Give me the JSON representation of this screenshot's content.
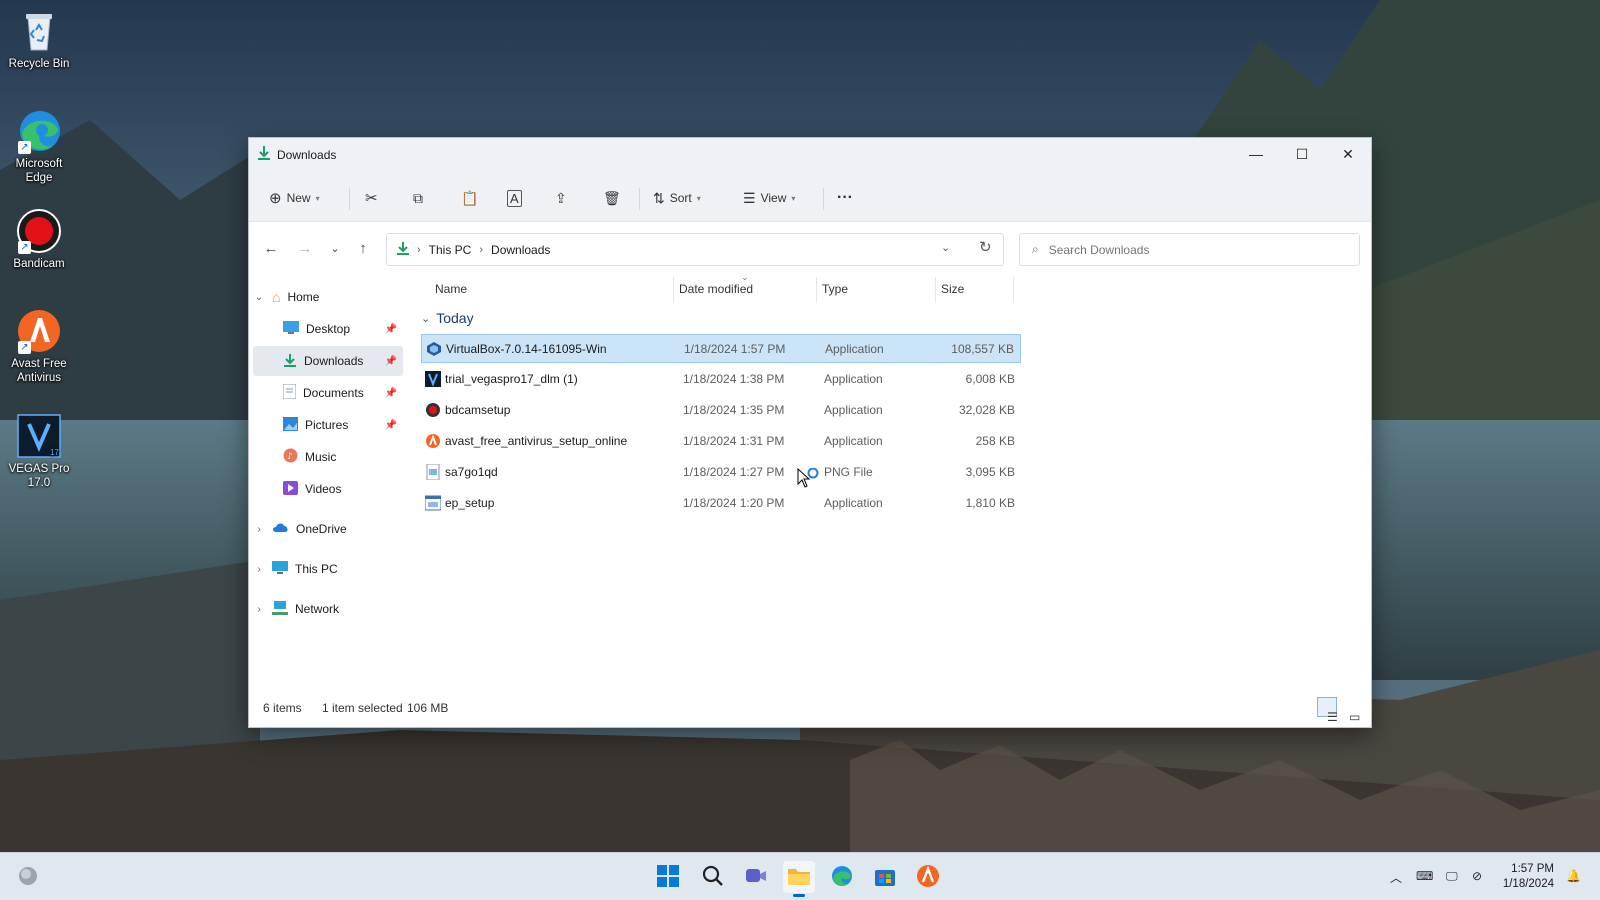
{
  "desktop": {
    "icons": [
      {
        "label": "Recycle Bin",
        "icon": "recycle-bin-icon"
      },
      {
        "label": "Microsoft Edge",
        "icon": "edge-icon"
      },
      {
        "label": "Bandicam",
        "icon": "bandicam-icon"
      },
      {
        "label": "Avast Free Antivirus",
        "icon": "avast-icon"
      },
      {
        "label": "VEGAS Pro 17.0",
        "icon": "vegas-icon"
      }
    ]
  },
  "window": {
    "title": "Downloads",
    "toolbar": {
      "new_label": "New",
      "sort_label": "Sort",
      "view_label": "View",
      "more_label": "···"
    },
    "address": {
      "crumbs": [
        "This PC",
        "Downloads"
      ],
      "search_placeholder": "Search Downloads"
    },
    "nav": {
      "home": "Home",
      "quick": [
        {
          "label": "Desktop",
          "pinned": true
        },
        {
          "label": "Downloads",
          "pinned": true,
          "selected": true
        },
        {
          "label": "Documents",
          "pinned": true
        },
        {
          "label": "Pictures",
          "pinned": true
        },
        {
          "label": "Music",
          "pinned": false
        },
        {
          "label": "Videos",
          "pinned": false
        }
      ],
      "onedrive": "OneDrive",
      "thispc": "This PC",
      "network": "Network"
    },
    "columns": {
      "name": "Name",
      "date": "Date modified",
      "type": "Type",
      "size": "Size"
    },
    "group": "Today",
    "files": [
      {
        "name": "VirtualBox-7.0.14-161095-Win",
        "date": "1/18/2024 1:57 PM",
        "type": "Application",
        "size": "108,557 KB",
        "selected": true,
        "icon": "virtualbox-icon"
      },
      {
        "name": "trial_vegaspro17_dlm (1)",
        "date": "1/18/2024 1:38 PM",
        "type": "Application",
        "size": "6,008 KB",
        "icon": "vegas-installer-icon"
      },
      {
        "name": "bdcamsetup",
        "date": "1/18/2024 1:35 PM",
        "type": "Application",
        "size": "32,028 KB",
        "icon": "bandicam-setup-icon"
      },
      {
        "name": "avast_free_antivirus_setup_online",
        "date": "1/18/2024 1:31 PM",
        "type": "Application",
        "size": "258 KB",
        "icon": "avast-setup-icon"
      },
      {
        "name": "sa7go1qd",
        "date": "1/18/2024 1:27 PM",
        "type": "PNG File",
        "size": "3,095 KB",
        "icon": "png-file-icon"
      },
      {
        "name": "ep_setup",
        "date": "1/18/2024 1:20 PM",
        "type": "Application",
        "size": "1,810 KB",
        "icon": "setup-app-icon"
      }
    ],
    "status": {
      "count": "6 items",
      "selection": "1 item selected",
      "selection_size": "106 MB"
    }
  },
  "taskbar": {
    "clock_time": "1:57 PM",
    "clock_date": "1/18/2024"
  },
  "colors": {
    "accent": "#0067c0",
    "selection_bg": "#cce4f7",
    "window_chrome": "#eef1f6"
  }
}
